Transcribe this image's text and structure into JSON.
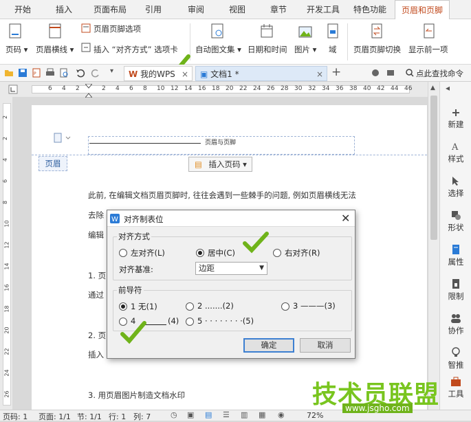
{
  "tabs": [
    "开始",
    "插入",
    "页面布局",
    "引用",
    "审阅",
    "视图",
    "章节",
    "开发工具",
    "特色功能",
    "页眉和页脚"
  ],
  "ribbon": {
    "page_num": "页码",
    "header_line": "页眉横线",
    "header_footer_options": "页眉页脚选项",
    "insert_align_tab": "插入 “对齐方式” 选项卡",
    "auto_text": "自动图文集",
    "date_time": "日期和时间",
    "picture": "图片",
    "field": "域",
    "switch": "页眉页脚切换",
    "show_prev": "显示前一项"
  },
  "quickbar": {
    "my_wps": "我的WPS",
    "doc_tab": "文档1 *",
    "find_cmd": "点此查找命令"
  },
  "ruler_ticks": [
    "6",
    "4",
    "2",
    "2",
    "4",
    "6",
    "8",
    "10",
    "12",
    "14",
    "16",
    "18",
    "20",
    "22",
    "24",
    "26",
    "28",
    "30",
    "32",
    "34",
    "36",
    "38",
    "40",
    "42",
    "44",
    "46"
  ],
  "vruler_ticks": [
    "2",
    "2",
    "4",
    "6",
    "8",
    "10",
    "12",
    "14",
    "16",
    "18",
    "20",
    "22",
    "24",
    "26"
  ],
  "document": {
    "header_text": "页眉与页脚",
    "header_badge": "页眉",
    "insert_page_num": "插入页码",
    "para1": "此前, 在编辑文档页眉页脚时, 往往会遇到一些棘手的问题, 例如页眉横线无法",
    "para2": "去除",
    "para3": "编辑",
    "item1": "1. 页",
    "para4": "通过",
    "item2": "2. 页",
    "para5": "插入",
    "item3": "3. 用页眉图片制造文档水印"
  },
  "side_panel": [
    "新建",
    "样式",
    "选择",
    "形状",
    "属性",
    "限制",
    "协作",
    "智推",
    "工具"
  ],
  "dialog": {
    "title": "对齐制表位",
    "align_group": "对齐方式",
    "left": "左对齐(L)",
    "center": "居中(C)",
    "right": "右对齐(R)",
    "align_base_label": "对齐基准:",
    "align_base_value": "边距",
    "leader_group": "前导符",
    "leader1": "1 无(1)",
    "leader2": "2 .......(2)",
    "leader3": "3 ———(3)",
    "leader4a": "4",
    "leader4b": "(4)",
    "leader5": "5 · · · · · · · ·(5)",
    "ok": "确定",
    "cancel": "取消",
    "selected_align": "center",
    "selected_leader": "1"
  },
  "status": {
    "page": "页码: 1",
    "pages": "页面: 1/1",
    "section": "节: 1/1",
    "row": "行: 1",
    "col": "列: 7",
    "zoom": "72%"
  },
  "watermark": {
    "main": "技术员联盟",
    "url": "www.jsgho.com"
  },
  "colors": {
    "accent": "#c14a1d",
    "check": "#6fb31a",
    "dialog_icon": "#2b7bd6"
  }
}
